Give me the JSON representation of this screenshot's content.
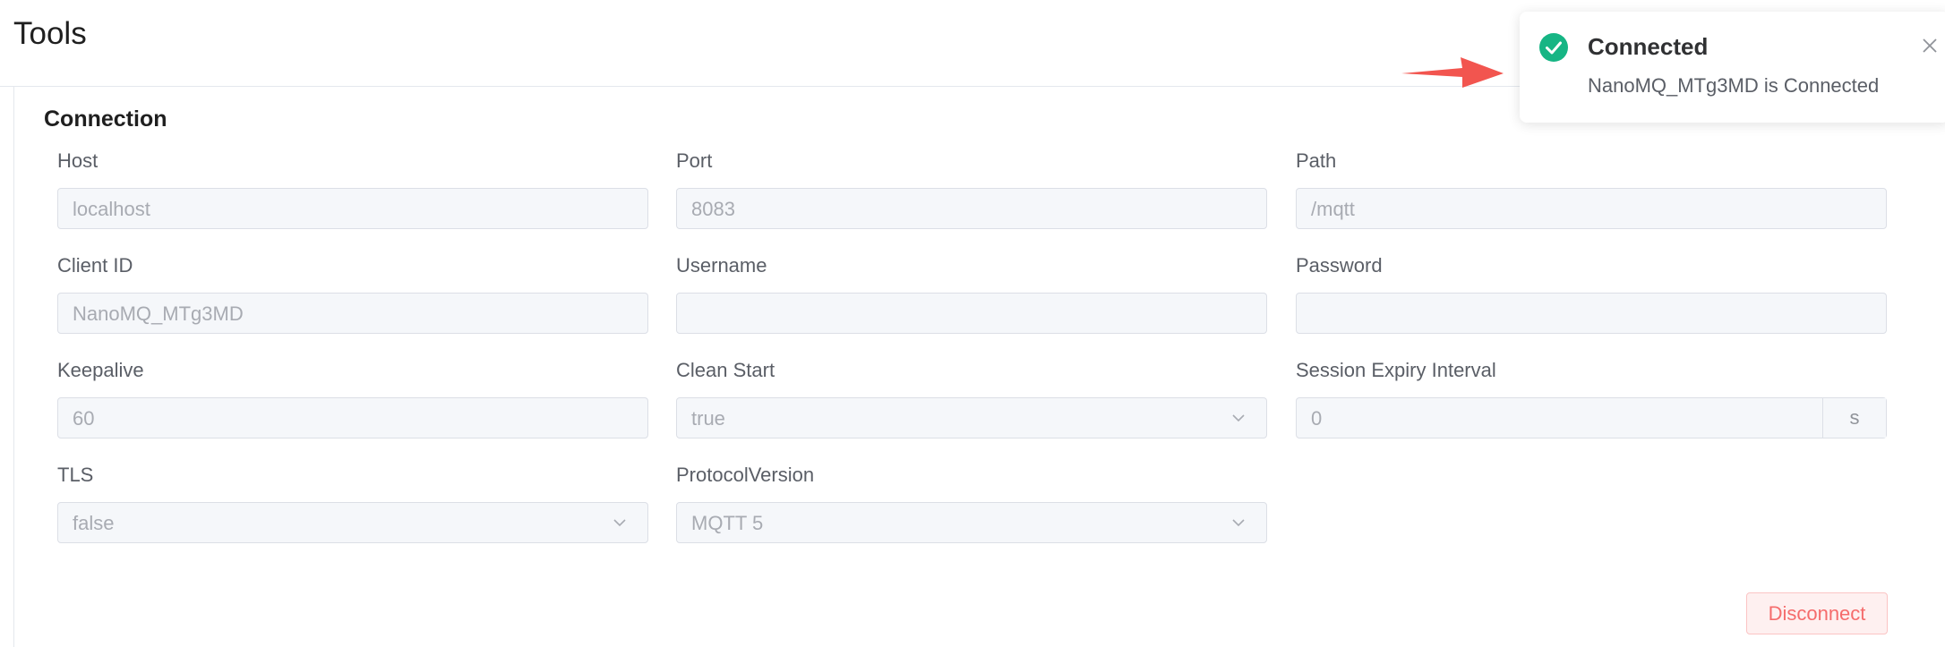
{
  "page": {
    "title": "Tools"
  },
  "section": {
    "title": "Connection"
  },
  "fields": {
    "host": {
      "label": "Host",
      "value": "localhost"
    },
    "port": {
      "label": "Port",
      "value": "8083"
    },
    "path": {
      "label": "Path",
      "value": "/mqtt"
    },
    "client_id": {
      "label": "Client ID",
      "value": "NanoMQ_MTg3MD"
    },
    "username": {
      "label": "Username",
      "value": ""
    },
    "password": {
      "label": "Password",
      "value": ""
    },
    "keepalive": {
      "label": "Keepalive",
      "value": "60"
    },
    "clean_start": {
      "label": "Clean Start",
      "value": "true"
    },
    "session_expiry": {
      "label": "Session Expiry Interval",
      "value": "0",
      "suffix": "s"
    },
    "tls": {
      "label": "TLS",
      "value": "false"
    },
    "protocol_version": {
      "label": "ProtocolVersion",
      "value": "MQTT 5"
    }
  },
  "actions": {
    "disconnect_label": "Disconnect"
  },
  "notification": {
    "title": "Connected",
    "message": "NanoMQ_MTg3MD is Connected",
    "icon": "check-circle-icon",
    "success_color": "#16b584"
  },
  "annotation": {
    "arrow_color": "#f2554f"
  }
}
